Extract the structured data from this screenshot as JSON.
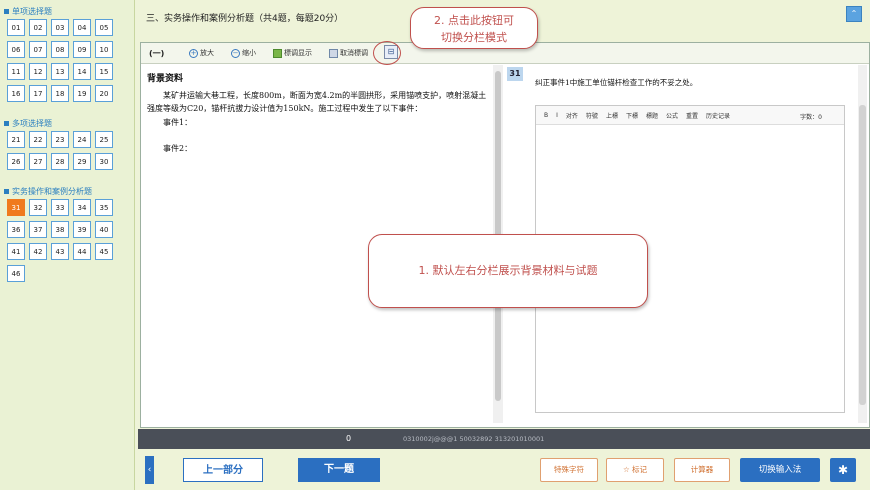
{
  "sidebar": {
    "sections": [
      {
        "title": "单项选择题",
        "items": [
          "01",
          "02",
          "03",
          "04",
          "05",
          "06",
          "07",
          "08",
          "09",
          "10",
          "11",
          "12",
          "13",
          "14",
          "15",
          "16",
          "17",
          "18",
          "19",
          "20"
        ]
      },
      {
        "title": "多项选择题",
        "items": [
          "21",
          "22",
          "23",
          "24",
          "25",
          "26",
          "27",
          "28",
          "29",
          "30"
        ]
      },
      {
        "title": "实务操作和案例分析题",
        "items": [
          "31",
          "32",
          "33",
          "34",
          "35",
          "36",
          "37",
          "38",
          "39",
          "40",
          "41",
          "42",
          "43",
          "44",
          "45",
          "46"
        ]
      }
    ],
    "current": "31"
  },
  "header": {
    "title": "三、实务操作和案例分析题（共4题，每题20分）",
    "icon": "collapse-icon"
  },
  "toolbar": {
    "part": "(一)",
    "zoom_in": "放大",
    "zoom_out": "缩小",
    "highlight": "標调显示",
    "cancel_highlight": "取消標调",
    "split_icon": "split-layout-icon"
  },
  "background": {
    "title": "背景资料",
    "para1": "某矿井运输大巷工程，长度800m，断面为宽4.2m的半圆拱形，采用锚喷支护，喷射混凝土强度等级为C20，锚杆抗拔力设计值为150kN。施工过程中发生了以下事件：",
    "event1": "事件1：",
    "event2": "事件2："
  },
  "question": {
    "number": "31",
    "text": "纠正事件1中施工单位锚杆检查工作的不妥之处。"
  },
  "editor": {
    "tools": [
      "B",
      "I",
      "对齐",
      "符號",
      "上標",
      "下標",
      "標题",
      "公式",
      "重置",
      "历史记录"
    ],
    "count_label": "字数：0"
  },
  "status": {
    "number": "0",
    "code": "0310002j@@@1 50032892 313201010001"
  },
  "bottom": {
    "prev": "上一部分",
    "next": "下一题",
    "special_chars": "特殊字符",
    "mark": "☆ 标记",
    "calculator": "计算器",
    "switch_input": "切换输入法",
    "settings_icon": "gear-icon"
  },
  "callouts": {
    "left_right": "1. 默认左右分栏展示背景材料与试题",
    "split_hint_line1": "2. 点击此按钮可",
    "split_hint_line2": "切换分栏模式"
  },
  "colors": {
    "accent": "#2b6fc1",
    "current_question": "#f07a1e",
    "callout": "#c0504d",
    "status_bar": "#4a4f58"
  }
}
